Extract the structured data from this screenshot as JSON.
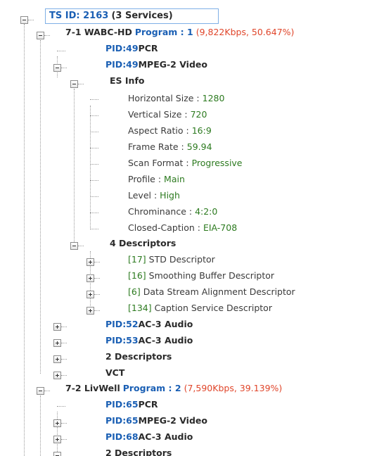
{
  "tree": {
    "root": {
      "prefix": "TS ID: 2163",
      "suffix": "(3 Services)"
    },
    "service1": {
      "name": "7-1 WABC-HD",
      "program_label": "Program : 1",
      "stats": "(9,822Kbps, 50.647%)"
    },
    "pid49_pcr": {
      "pid": "PID:49",
      "label": "PCR"
    },
    "pid49_video": {
      "pid": "PID:49",
      "label": "MPEG-2 Video"
    },
    "es_info": {
      "label": "ES Info"
    },
    "es_fields": [
      {
        "key": "Horizontal Size :",
        "value": "1280"
      },
      {
        "key": "Vertical Size :",
        "value": "720"
      },
      {
        "key": "Aspect Ratio :",
        "value": "16:9"
      },
      {
        "key": "Frame Rate :",
        "value": "59.94"
      },
      {
        "key": "Scan Format :",
        "value": "Progressive"
      },
      {
        "key": "Profile :",
        "value": "Main"
      },
      {
        "key": "Level :",
        "value": "High"
      },
      {
        "key": "Chrominance :",
        "value": "4:2:0"
      },
      {
        "key": "Closed-Caption :",
        "value": "EIA-708"
      }
    ],
    "descriptors_group": {
      "label": "4 Descriptors"
    },
    "descriptors": [
      {
        "tag": "[17]",
        "name": "STD Descriptor"
      },
      {
        "tag": "[16]",
        "name": "Smoothing Buffer Descriptor"
      },
      {
        "tag": "[6]",
        "name": "Data Stream Alignment Descriptor"
      },
      {
        "tag": "[134]",
        "name": "Caption Service Descriptor"
      }
    ],
    "pid52": {
      "pid": "PID:52",
      "label": "AC-3 Audio"
    },
    "pid53": {
      "pid": "PID:53",
      "label": "AC-3 Audio"
    },
    "svc1_descriptors": {
      "label": "2 Descriptors"
    },
    "vct": {
      "label": "VCT"
    },
    "service2": {
      "name": "7-2 LivWell",
      "program_label": "Program : 2",
      "stats": "(7,590Kbps, 39.139%)"
    },
    "pid65_pcr": {
      "pid": "PID:65",
      "label": "PCR"
    },
    "pid65_video": {
      "pid": "PID:65",
      "label": "MPEG-2 Video"
    },
    "pid68": {
      "pid": "PID:68",
      "label": "AC-3 Audio"
    },
    "svc2_descriptors": {
      "label": "2 Descriptors"
    }
  },
  "colors": {
    "blue": "#1a5fb4",
    "green": "#2c7a1f",
    "red": "#e0452a",
    "selection_border": "#7fb0e6"
  }
}
